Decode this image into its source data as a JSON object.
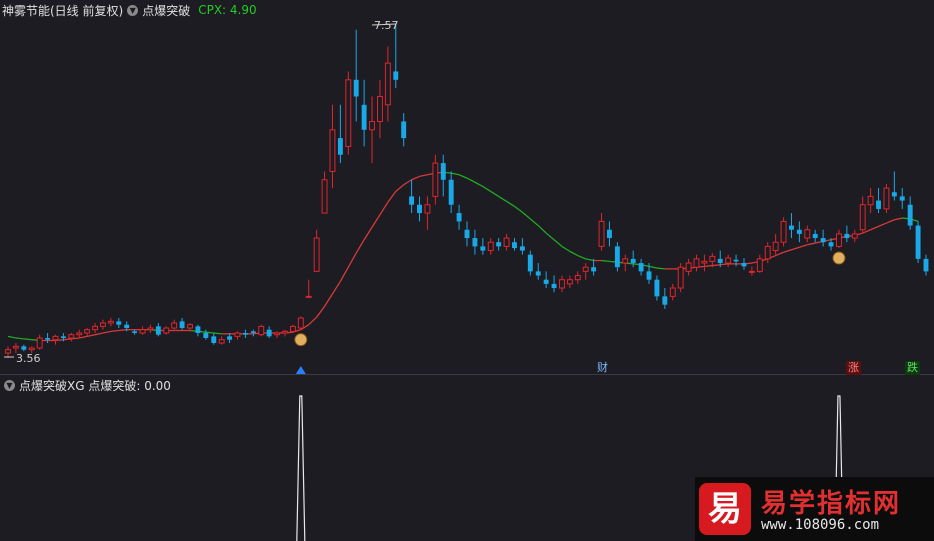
{
  "main_panel": {
    "title": "神雾节能(日线 前复权)",
    "indicator": "点爆突破",
    "cpx_label": "CPX: 4.90",
    "max_price_label": "7.57",
    "min_price_label": "3.56"
  },
  "sub_panel": {
    "title": "点爆突破XG  点爆突破: 0.00"
  },
  "markers": {
    "cai": "财",
    "zhang": "涨",
    "die": "跌"
  },
  "watermark": {
    "logo_char": "易",
    "title": "易学指标网",
    "url": "www.108096.com"
  },
  "colors": {
    "up": "#e0262c",
    "down": "#1aa9e8",
    "ma_up": "#d63a3a",
    "ma_down": "#22aa22",
    "background": "#1c1c22"
  },
  "chart_data": {
    "type": "candlestick",
    "price_range": [
      3.56,
      7.57
    ],
    "candles": [
      {
        "o": 3.62,
        "h": 3.7,
        "l": 3.56,
        "c": 3.66
      },
      {
        "o": 3.68,
        "h": 3.74,
        "l": 3.62,
        "c": 3.7
      },
      {
        "o": 3.7,
        "h": 3.72,
        "l": 3.64,
        "c": 3.66
      },
      {
        "o": 3.66,
        "h": 3.7,
        "l": 3.62,
        "c": 3.68
      },
      {
        "o": 3.68,
        "h": 3.84,
        "l": 3.66,
        "c": 3.8
      },
      {
        "o": 3.8,
        "h": 3.86,
        "l": 3.74,
        "c": 3.78
      },
      {
        "o": 3.78,
        "h": 3.84,
        "l": 3.72,
        "c": 3.82
      },
      {
        "o": 3.82,
        "h": 3.86,
        "l": 3.76,
        "c": 3.8
      },
      {
        "o": 3.8,
        "h": 3.86,
        "l": 3.76,
        "c": 3.84
      },
      {
        "o": 3.84,
        "h": 3.9,
        "l": 3.8,
        "c": 3.86
      },
      {
        "o": 3.86,
        "h": 3.92,
        "l": 3.82,
        "c": 3.9
      },
      {
        "o": 3.9,
        "h": 3.98,
        "l": 3.86,
        "c": 3.94
      },
      {
        "o": 3.94,
        "h": 4.02,
        "l": 3.9,
        "c": 3.98
      },
      {
        "o": 3.98,
        "h": 4.04,
        "l": 3.94,
        "c": 4.0
      },
      {
        "o": 4.0,
        "h": 4.04,
        "l": 3.92,
        "c": 3.96
      },
      {
        "o": 3.96,
        "h": 4.0,
        "l": 3.88,
        "c": 3.92
      },
      {
        "o": 3.88,
        "h": 3.9,
        "l": 3.84,
        "c": 3.86
      },
      {
        "o": 3.86,
        "h": 3.94,
        "l": 3.84,
        "c": 3.9
      },
      {
        "o": 3.9,
        "h": 3.96,
        "l": 3.86,
        "c": 3.92
      },
      {
        "o": 3.94,
        "h": 3.98,
        "l": 3.82,
        "c": 3.84
      },
      {
        "o": 3.86,
        "h": 3.94,
        "l": 3.84,
        "c": 3.92
      },
      {
        "o": 3.92,
        "h": 4.02,
        "l": 3.9,
        "c": 3.98
      },
      {
        "o": 4.0,
        "h": 4.04,
        "l": 3.9,
        "c": 3.92
      },
      {
        "o": 3.92,
        "h": 3.98,
        "l": 3.88,
        "c": 3.96
      },
      {
        "o": 3.94,
        "h": 3.96,
        "l": 3.82,
        "c": 3.86
      },
      {
        "o": 3.86,
        "h": 3.9,
        "l": 3.78,
        "c": 3.8
      },
      {
        "o": 3.82,
        "h": 3.86,
        "l": 3.72,
        "c": 3.74
      },
      {
        "o": 3.74,
        "h": 3.82,
        "l": 3.72,
        "c": 3.78
      },
      {
        "o": 3.82,
        "h": 3.86,
        "l": 3.74,
        "c": 3.78
      },
      {
        "o": 3.82,
        "h": 3.88,
        "l": 3.78,
        "c": 3.86
      },
      {
        "o": 3.86,
        "h": 3.9,
        "l": 3.8,
        "c": 3.84
      },
      {
        "o": 3.88,
        "h": 3.9,
        "l": 3.82,
        "c": 3.86
      },
      {
        "o": 3.84,
        "h": 3.96,
        "l": 3.82,
        "c": 3.94
      },
      {
        "o": 3.9,
        "h": 3.94,
        "l": 3.8,
        "c": 3.82
      },
      {
        "o": 3.84,
        "h": 3.88,
        "l": 3.8,
        "c": 3.86
      },
      {
        "o": 3.86,
        "h": 3.9,
        "l": 3.82,
        "c": 3.88
      },
      {
        "o": 3.88,
        "h": 3.96,
        "l": 3.86,
        "c": 3.94
      },
      {
        "o": 3.92,
        "h": 4.06,
        "l": 3.9,
        "c": 4.04
      },
      {
        "o": 4.3,
        "h": 4.5,
        "l": 4.28,
        "c": 4.3
      },
      {
        "o": 4.6,
        "h": 5.1,
        "l": 4.6,
        "c": 5.0
      },
      {
        "o": 5.3,
        "h": 5.8,
        "l": 5.3,
        "c": 5.7
      },
      {
        "o": 5.8,
        "h": 6.6,
        "l": 5.6,
        "c": 6.3
      },
      {
        "o": 6.2,
        "h": 6.6,
        "l": 5.9,
        "c": 6.0
      },
      {
        "o": 6.1,
        "h": 7.0,
        "l": 6.0,
        "c": 6.9
      },
      {
        "o": 6.9,
        "h": 7.5,
        "l": 6.4,
        "c": 6.7
      },
      {
        "o": 6.6,
        "h": 6.9,
        "l": 6.1,
        "c": 6.3
      },
      {
        "o": 6.3,
        "h": 6.7,
        "l": 5.9,
        "c": 6.4
      },
      {
        "o": 6.4,
        "h": 6.9,
        "l": 6.2,
        "c": 6.7
      },
      {
        "o": 6.6,
        "h": 7.3,
        "l": 6.4,
        "c": 7.1
      },
      {
        "o": 7.0,
        "h": 7.57,
        "l": 6.8,
        "c": 6.9
      },
      {
        "o": 6.4,
        "h": 6.5,
        "l": 6.1,
        "c": 6.2
      },
      {
        "o": 5.5,
        "h": 5.7,
        "l": 5.3,
        "c": 5.4
      },
      {
        "o": 5.4,
        "h": 5.5,
        "l": 5.2,
        "c": 5.3
      },
      {
        "o": 5.3,
        "h": 5.5,
        "l": 5.1,
        "c": 5.4
      },
      {
        "o": 5.5,
        "h": 6.0,
        "l": 5.4,
        "c": 5.9
      },
      {
        "o": 5.9,
        "h": 6.0,
        "l": 5.5,
        "c": 5.7
      },
      {
        "o": 5.7,
        "h": 5.8,
        "l": 5.3,
        "c": 5.4
      },
      {
        "o": 5.3,
        "h": 5.4,
        "l": 5.1,
        "c": 5.2
      },
      {
        "o": 5.1,
        "h": 5.2,
        "l": 4.9,
        "c": 5.0
      },
      {
        "o": 5.0,
        "h": 5.1,
        "l": 4.8,
        "c": 4.9
      },
      {
        "o": 4.9,
        "h": 5.0,
        "l": 4.8,
        "c": 4.85
      },
      {
        "o": 4.85,
        "h": 5.0,
        "l": 4.8,
        "c": 4.95
      },
      {
        "o": 4.95,
        "h": 5.0,
        "l": 4.85,
        "c": 4.9
      },
      {
        "o": 4.9,
        "h": 5.05,
        "l": 4.85,
        "c": 5.0
      },
      {
        "o": 4.95,
        "h": 5.0,
        "l": 4.85,
        "c": 4.88
      },
      {
        "o": 4.9,
        "h": 5.0,
        "l": 4.8,
        "c": 4.85
      },
      {
        "o": 4.8,
        "h": 4.85,
        "l": 4.55,
        "c": 4.6
      },
      {
        "o": 4.6,
        "h": 4.7,
        "l": 4.5,
        "c": 4.55
      },
      {
        "o": 4.5,
        "h": 4.6,
        "l": 4.4,
        "c": 4.45
      },
      {
        "o": 4.45,
        "h": 4.55,
        "l": 4.35,
        "c": 4.4
      },
      {
        "o": 4.4,
        "h": 4.55,
        "l": 4.35,
        "c": 4.5
      },
      {
        "o": 4.45,
        "h": 4.55,
        "l": 4.4,
        "c": 4.5
      },
      {
        "o": 4.5,
        "h": 4.6,
        "l": 4.45,
        "c": 4.55
      },
      {
        "o": 4.6,
        "h": 4.7,
        "l": 4.5,
        "c": 4.65
      },
      {
        "o": 4.65,
        "h": 4.75,
        "l": 4.55,
        "c": 4.6
      },
      {
        "o": 4.9,
        "h": 5.3,
        "l": 4.85,
        "c": 5.2
      },
      {
        "o": 5.1,
        "h": 5.2,
        "l": 4.9,
        "c": 5.0
      },
      {
        "o": 4.9,
        "h": 4.95,
        "l": 4.6,
        "c": 4.65
      },
      {
        "o": 4.7,
        "h": 4.8,
        "l": 4.6,
        "c": 4.75
      },
      {
        "o": 4.75,
        "h": 4.85,
        "l": 4.65,
        "c": 4.7
      },
      {
        "o": 4.7,
        "h": 4.75,
        "l": 4.55,
        "c": 4.6
      },
      {
        "o": 4.6,
        "h": 4.7,
        "l": 4.45,
        "c": 4.5
      },
      {
        "o": 4.5,
        "h": 4.55,
        "l": 4.25,
        "c": 4.3
      },
      {
        "o": 4.3,
        "h": 4.4,
        "l": 4.15,
        "c": 4.2
      },
      {
        "o": 4.3,
        "h": 4.45,
        "l": 4.25,
        "c": 4.4
      },
      {
        "o": 4.4,
        "h": 4.7,
        "l": 4.35,
        "c": 4.65
      },
      {
        "o": 4.6,
        "h": 4.75,
        "l": 4.55,
        "c": 4.7
      },
      {
        "o": 4.65,
        "h": 4.8,
        "l": 4.6,
        "c": 4.75
      },
      {
        "o": 4.7,
        "h": 4.8,
        "l": 4.6,
        "c": 4.72
      },
      {
        "o": 4.72,
        "h": 4.82,
        "l": 4.65,
        "c": 4.78
      },
      {
        "o": 4.75,
        "h": 4.85,
        "l": 4.65,
        "c": 4.7
      },
      {
        "o": 4.7,
        "h": 4.8,
        "l": 4.65,
        "c": 4.76
      },
      {
        "o": 4.74,
        "h": 4.8,
        "l": 4.66,
        "c": 4.72
      },
      {
        "o": 4.7,
        "h": 4.76,
        "l": 4.62,
        "c": 4.66
      },
      {
        "o": 4.6,
        "h": 4.66,
        "l": 4.55,
        "c": 4.6
      },
      {
        "o": 4.6,
        "h": 4.8,
        "l": 4.58,
        "c": 4.75
      },
      {
        "o": 4.75,
        "h": 4.95,
        "l": 4.7,
        "c": 4.9
      },
      {
        "o": 4.85,
        "h": 5.05,
        "l": 4.8,
        "c": 4.95
      },
      {
        "o": 4.95,
        "h": 5.25,
        "l": 4.9,
        "c": 5.2
      },
      {
        "o": 5.15,
        "h": 5.3,
        "l": 5.0,
        "c": 5.1
      },
      {
        "o": 5.1,
        "h": 5.2,
        "l": 4.95,
        "c": 5.05
      },
      {
        "o": 5.0,
        "h": 5.15,
        "l": 4.95,
        "c": 5.1
      },
      {
        "o": 5.05,
        "h": 5.1,
        "l": 4.95,
        "c": 5.0
      },
      {
        "o": 5.0,
        "h": 5.1,
        "l": 4.9,
        "c": 4.95
      },
      {
        "o": 4.95,
        "h": 5.0,
        "l": 4.85,
        "c": 4.9
      },
      {
        "o": 4.9,
        "h": 5.1,
        "l": 4.88,
        "c": 5.05
      },
      {
        "o": 5.05,
        "h": 5.15,
        "l": 4.95,
        "c": 5.0
      },
      {
        "o": 5.0,
        "h": 5.1,
        "l": 4.95,
        "c": 5.05
      },
      {
        "o": 5.1,
        "h": 5.5,
        "l": 5.05,
        "c": 5.4
      },
      {
        "o": 5.4,
        "h": 5.6,
        "l": 5.3,
        "c": 5.5
      },
      {
        "o": 5.45,
        "h": 5.6,
        "l": 5.3,
        "c": 5.35
      },
      {
        "o": 5.35,
        "h": 5.65,
        "l": 5.3,
        "c": 5.6
      },
      {
        "o": 5.55,
        "h": 5.8,
        "l": 5.45,
        "c": 5.5
      },
      {
        "o": 5.5,
        "h": 5.6,
        "l": 5.35,
        "c": 5.45
      },
      {
        "o": 5.4,
        "h": 5.5,
        "l": 5.1,
        "c": 5.15
      },
      {
        "o": 5.15,
        "h": 5.2,
        "l": 4.7,
        "c": 4.75
      },
      {
        "o": 4.75,
        "h": 4.8,
        "l": 4.55,
        "c": 4.6
      }
    ],
    "ma": [
      3.82,
      3.8,
      3.79,
      3.78,
      3.77,
      3.77,
      3.77,
      3.78,
      3.79,
      3.8,
      3.82,
      3.84,
      3.86,
      3.88,
      3.89,
      3.9,
      3.9,
      3.9,
      3.9,
      3.89,
      3.89,
      3.89,
      3.89,
      3.89,
      3.88,
      3.87,
      3.86,
      3.85,
      3.85,
      3.85,
      3.85,
      3.85,
      3.86,
      3.86,
      3.86,
      3.86,
      3.87,
      3.9,
      3.96,
      4.05,
      4.18,
      4.33,
      4.48,
      4.65,
      4.82,
      4.98,
      5.13,
      5.28,
      5.43,
      5.56,
      5.64,
      5.7,
      5.74,
      5.76,
      5.78,
      5.79,
      5.78,
      5.76,
      5.72,
      5.67,
      5.62,
      5.56,
      5.5,
      5.44,
      5.38,
      5.31,
      5.23,
      5.15,
      5.06,
      4.98,
      4.9,
      4.84,
      4.79,
      4.75,
      4.73,
      4.73,
      4.72,
      4.71,
      4.7,
      4.69,
      4.68,
      4.66,
      4.64,
      4.63,
      4.63,
      4.63,
      4.64,
      4.65,
      4.66,
      4.67,
      4.68,
      4.69,
      4.69,
      4.69,
      4.7,
      4.72,
      4.75,
      4.79,
      4.83,
      4.86,
      4.89,
      4.92,
      4.94,
      4.96,
      4.98,
      5.0,
      5.02,
      5.03,
      5.06,
      5.1,
      5.14,
      5.18,
      5.22,
      5.24,
      5.23,
      5.2
    ],
    "ma_color_switch": [
      36,
      68,
      88,
      112
    ],
    "signals": [
      37,
      105
    ]
  }
}
